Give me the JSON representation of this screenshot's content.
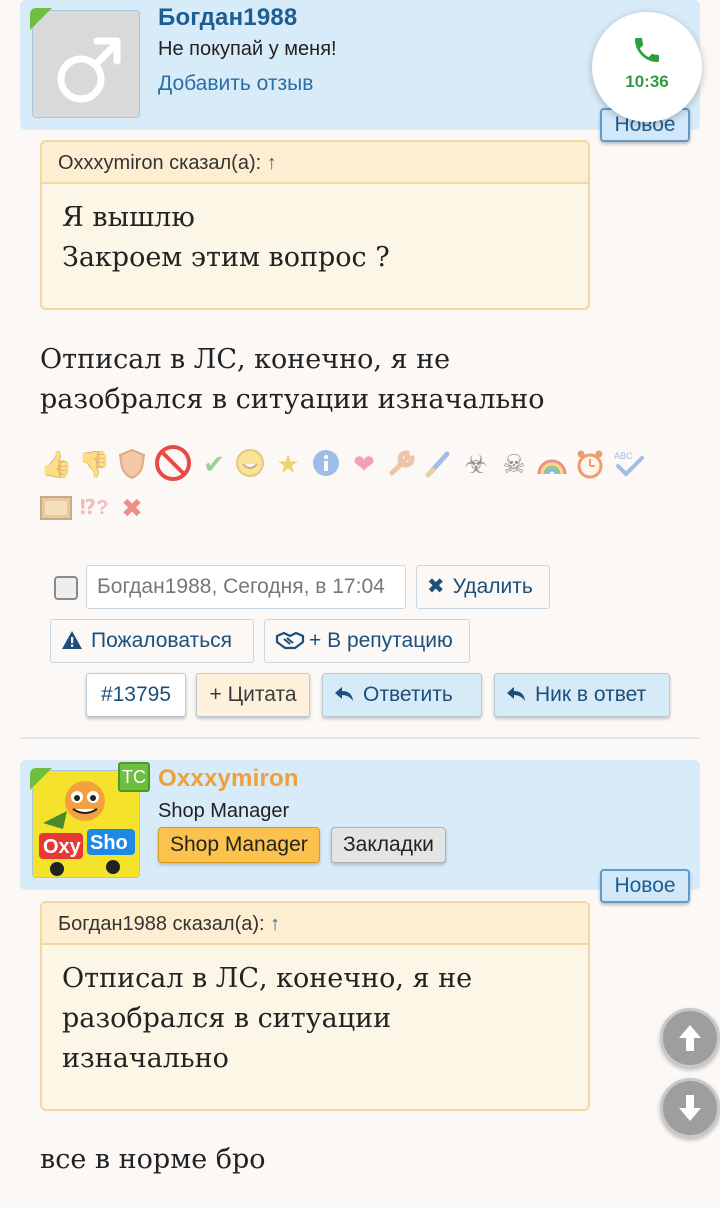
{
  "post1": {
    "username": "Богдан1988",
    "user_title": "Не покупай у меня!",
    "add_review": "Добавить отзыв",
    "new_badge": "Новое",
    "quote": {
      "author_line": "Oxxxymiron сказал(а):",
      "arrow": "↑",
      "lines": [
        "Я вышлю",
        "Закроем этим вопрос ?"
      ]
    },
    "text_lines": [
      "Отписал в ЛС, конечно, я не",
      "разобрался в ситуации изначально"
    ],
    "reactions": [
      "like",
      "dislike",
      "shield",
      "prohibited",
      "check",
      "smile",
      "star-medal",
      "info",
      "heart",
      "wrench",
      "brush",
      "biohazard",
      "skull",
      "rainbow",
      "alarm-clock",
      "abc-check",
      "archive-box",
      "question-marks",
      "red-cross"
    ],
    "meta": {
      "author": "Богдан1988",
      "date": ", Сегодня, в 17:04"
    },
    "actions": {
      "delete": "Удалить",
      "report": "Пожаловаться",
      "reputation": "+ В репутацию",
      "post_number": "#13795",
      "quote": "+ Цитата",
      "reply": "Ответить",
      "nick_reply": "Ник в ответ"
    }
  },
  "post2": {
    "ts_badge": "ТС",
    "username": "Oxxxymiron",
    "user_title": "Shop Manager",
    "role_button": "Shop Manager",
    "bookmarks_button": "Закладки",
    "new_badge": "Новое",
    "quote": {
      "author_line": "Богдан1988 сказал(а):",
      "arrow": "↑",
      "lines": [
        "Отписал в ЛС, конечно, я не",
        "разобрался в ситуации",
        "изначально"
      ]
    },
    "text": "все в норме бро"
  },
  "call": {
    "time": "10:36"
  },
  "colors": {
    "username_blue": "#1c5d94",
    "username_orange": "#f0a03a",
    "panel_blue": "#d8ebf9",
    "quote_border": "#f3d7a3",
    "accent_green": "#6ebe3f"
  }
}
